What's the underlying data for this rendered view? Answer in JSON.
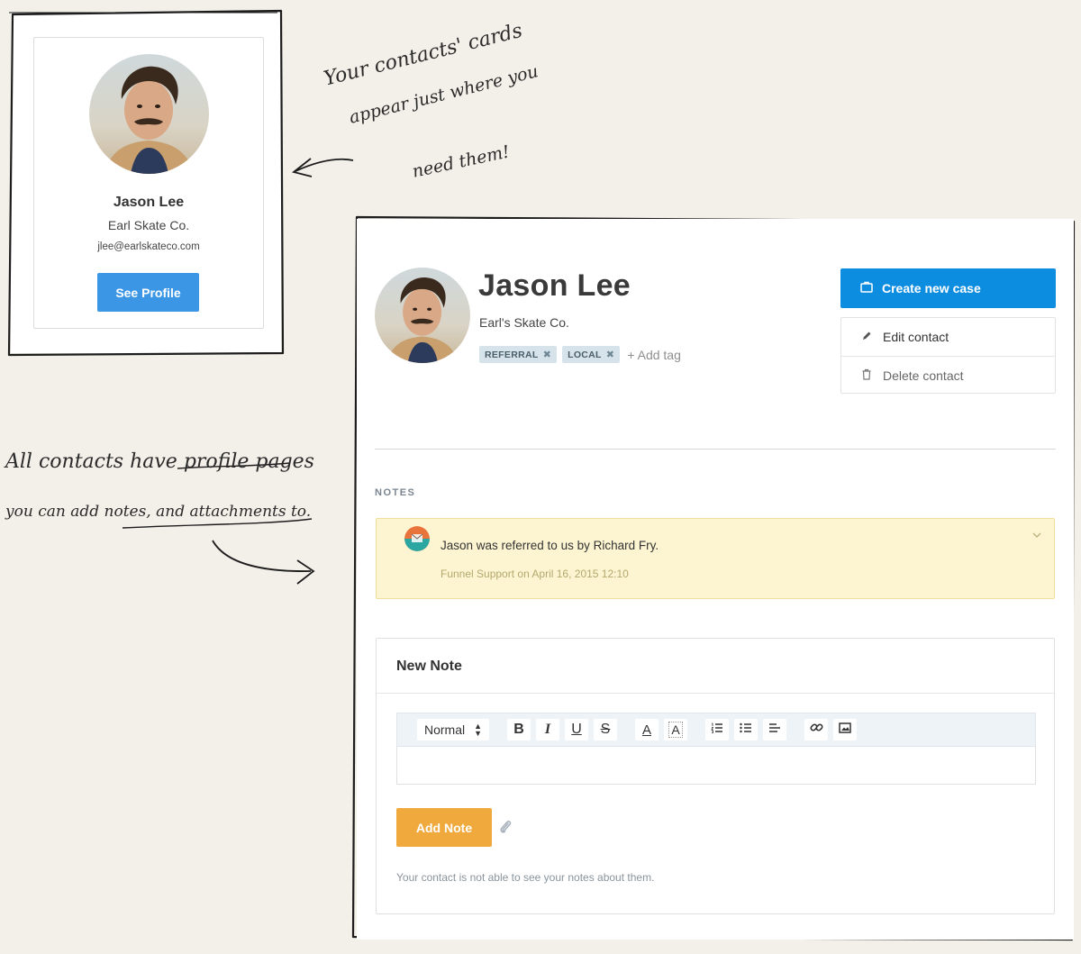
{
  "card": {
    "name": "Jason Lee",
    "company": "Earl Skate Co.",
    "email": "jlee@earlskateco.com",
    "button_label": "See Profile"
  },
  "annotations": {
    "top_line1": "Your contacts' cards",
    "top_line2": "appear just where you",
    "top_line3": "need them!",
    "left_line1": "All contacts have profile pages",
    "left_line2": "you can add notes, and attachments to."
  },
  "profile": {
    "name": "Jason Lee",
    "company": "Earl's Skate Co.",
    "tags": [
      "REFERRAL",
      "LOCAL"
    ],
    "tag_remove_glyph": "✖",
    "add_tag_label": "+ Add tag"
  },
  "actions": {
    "create_case_label": "Create new case",
    "edit_contact_label": "Edit contact",
    "delete_contact_label": "Delete contact"
  },
  "notes": {
    "section_label": "NOTES",
    "items": [
      {
        "text": "Jason was referred to us by Richard Fry.",
        "meta": "Funnel Support on April 16, 2015 12:10"
      }
    ]
  },
  "new_note": {
    "title": "New Note",
    "format_select_value": "Normal",
    "add_button_label": "Add Note",
    "disclaimer": "Your contact is not able to see your notes about them."
  },
  "colors": {
    "page_bg": "#f3efe9",
    "primary_blue": "#0d8de0",
    "card_button_blue": "#3b96e5",
    "add_note_orange": "#f0a93c",
    "note_bg": "#fdf5d2",
    "tag_bg": "#d6e3ea"
  }
}
